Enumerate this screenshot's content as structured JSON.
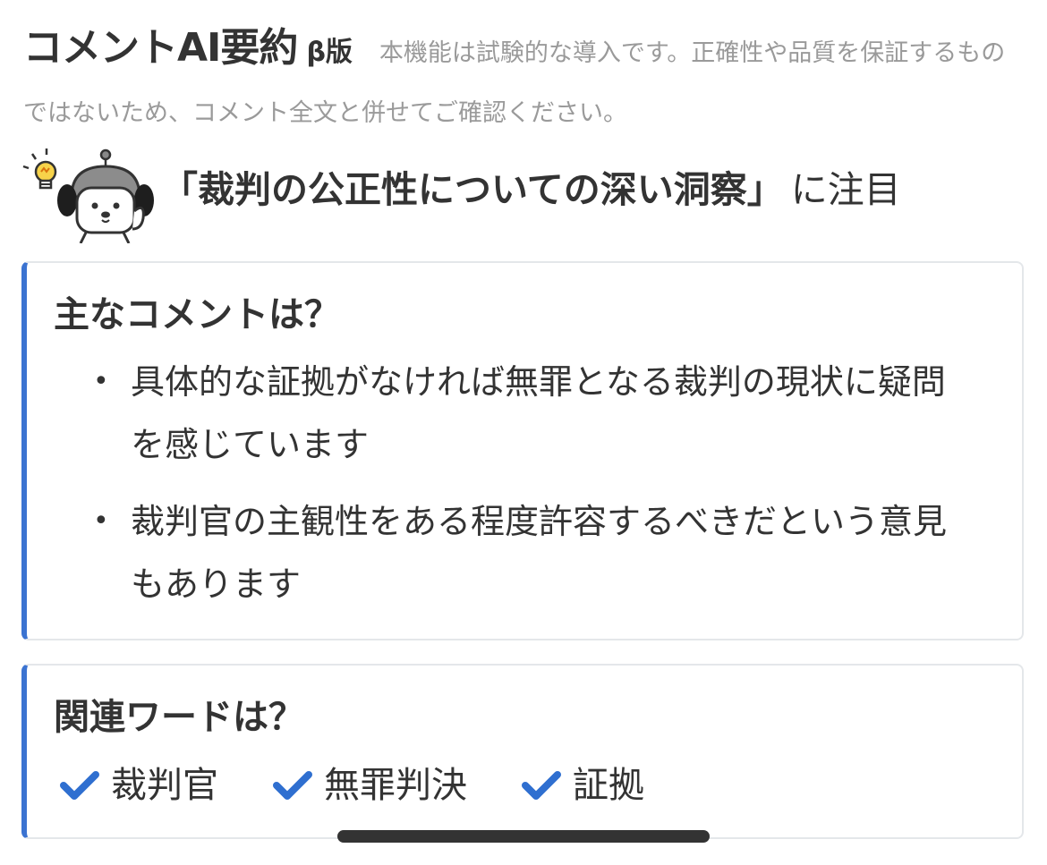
{
  "header": {
    "title": "コメントAI要約",
    "beta_label": "β版",
    "disclaimer": "本機能は試験的な導入です。正確性や品質を保証するものではないため、コメント全文と併せてご確認ください。"
  },
  "focus": {
    "topic": "「裁判の公正性についての深い洞察」",
    "suffix": "に注目"
  },
  "main_comments": {
    "heading": "主なコメントは？",
    "items": [
      "具体的な証拠がなければ無罪となる裁判の現状に疑問を感じています",
      "裁判官の主観性をある程度許容するべきだという意見もあります"
    ]
  },
  "related_words": {
    "heading": "関連ワードは？",
    "items": [
      "裁判官",
      "無罪判決",
      "証拠"
    ]
  },
  "icons": {
    "mascot": "robot-dog-mascot-icon",
    "lightbulb": "lightbulb-icon",
    "check": "check-icon",
    "bullet": "•"
  },
  "colors": {
    "accent": "#3b73d1",
    "check": "#2f6fd0",
    "muted_text": "#9a9a9a",
    "text": "#333333"
  }
}
